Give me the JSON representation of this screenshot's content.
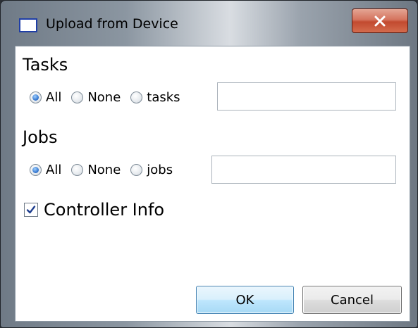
{
  "window": {
    "title": "Upload from Device",
    "close_glyph": "x"
  },
  "tasks": {
    "heading": "Tasks",
    "options": [
      "All",
      "None",
      "tasks"
    ],
    "selected": "All",
    "input_value": ""
  },
  "jobs": {
    "heading": "Jobs",
    "options": [
      "All",
      "None",
      "jobs"
    ],
    "selected": "All",
    "input_value": ""
  },
  "controller_info": {
    "label": "Controller Info",
    "checked": true
  },
  "buttons": {
    "ok": "OK",
    "cancel": "Cancel"
  },
  "colors": {
    "close_button": "#c24a2f",
    "radio_selected": "#2a6dc9",
    "ok_border": "#3c7fb1"
  },
  "icons": {
    "window": "window-icon",
    "close": "close-icon",
    "check": "checkmark-icon"
  }
}
